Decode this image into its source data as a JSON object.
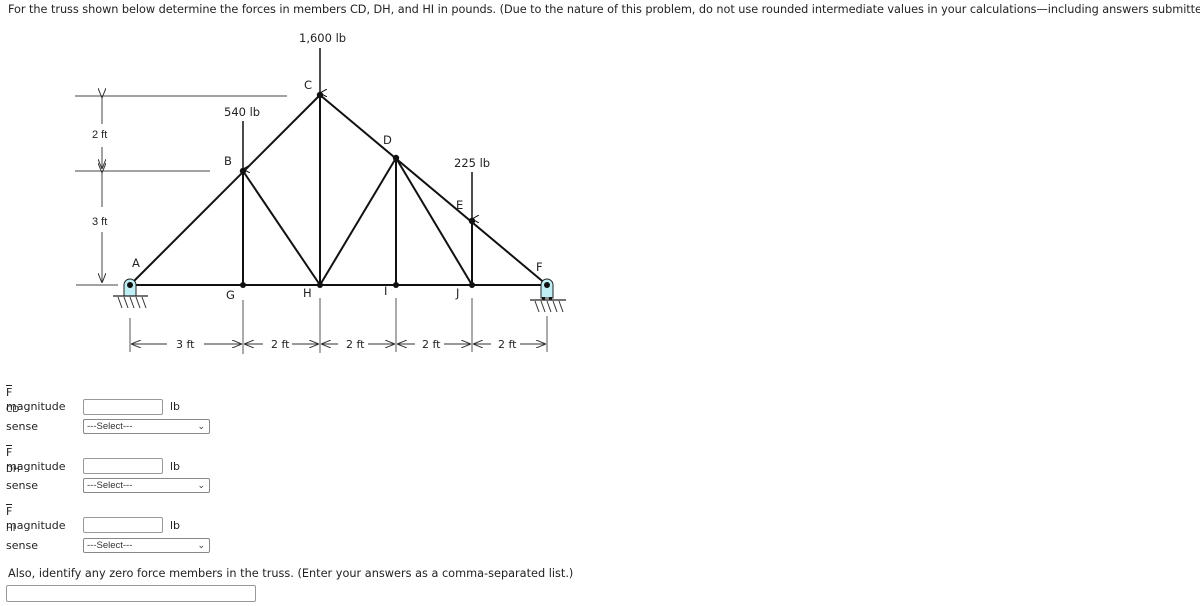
{
  "question": {
    "prompt": "For the truss shown below determine the forces in members CD, DH, and HI in pounds. (Due to the nature of this problem, do not use rounded intermediate values in your calculations—including answers submitted in WebAssign.)"
  },
  "figure": {
    "loads": [
      {
        "joint": "C",
        "label": "1,600 lb"
      },
      {
        "joint": "B",
        "label": "540 lb"
      },
      {
        "joint": "E",
        "label": "225 lb"
      }
    ],
    "joints": [
      "A",
      "B",
      "C",
      "D",
      "E",
      "F",
      "G",
      "H",
      "I",
      "J"
    ],
    "vertical_dimensions": [
      "2 ft",
      "3 ft"
    ],
    "horizontal_dimensions": [
      "3 ft",
      "2 ft",
      "2 ft",
      "2 ft",
      "2 ft"
    ],
    "colors": {
      "member": "#111111",
      "support_fill": "#bfeff5",
      "dimension_line": "#444444"
    }
  },
  "answers": [
    {
      "force": "F",
      "subscript": "CD",
      "magnitude_label": "magnitude",
      "magnitude_value": "",
      "unit": "lb",
      "sense_label": "sense",
      "sense_selected": "---Select---"
    },
    {
      "force": "F",
      "subscript": "DH",
      "magnitude_label": "magnitude",
      "magnitude_value": "",
      "unit": "lb",
      "sense_label": "sense",
      "sense_selected": "---Select---"
    },
    {
      "force": "F",
      "subscript": "HI",
      "magnitude_label": "magnitude",
      "magnitude_value": "",
      "unit": "lb",
      "sense_label": "sense",
      "sense_selected": "---Select---"
    }
  ],
  "zero_force": {
    "prompt": "Also, identify any zero force members in the truss. (Enter your answers as a comma-separated list.)",
    "value": ""
  }
}
